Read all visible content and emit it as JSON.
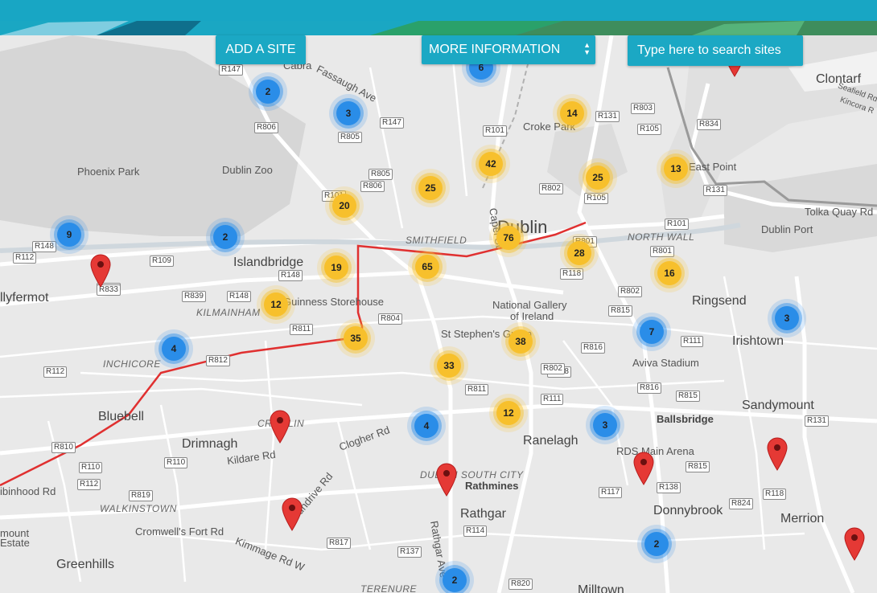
{
  "toolbar": {
    "add_site": "ADD A SITE",
    "more_info": "MORE INFORMATION",
    "search_placeholder": "Type here to search sites"
  },
  "colors": {
    "accent": "#1ba8c4",
    "cluster_yellow": "#f7c02c",
    "cluster_blue": "#2a8de8",
    "pin_red": "#e53935",
    "route_red": "#e03030"
  },
  "map": {
    "place_labels": [
      {
        "text": "Cabra",
        "style": "lbl"
      },
      {
        "text": "Fassaugh Ave",
        "style": "lbl"
      },
      {
        "text": "Clontarf",
        "style": "big"
      },
      {
        "text": "Seafield Rd",
        "style": "lbl"
      },
      {
        "text": "Kincora R",
        "style": "lbl"
      },
      {
        "text": "Phoenix Park",
        "style": "lbl"
      },
      {
        "text": "Dublin Zoo",
        "style": "lbl"
      },
      {
        "text": "Croke Park",
        "style": "lbl"
      },
      {
        "text": "East Point",
        "style": "lbl"
      },
      {
        "text": "Dublin",
        "style": "city"
      },
      {
        "text": "Tolka Quay Rd",
        "style": "lbl"
      },
      {
        "text": "Dublin Port",
        "style": "lbl"
      },
      {
        "text": "SMITHFIELD",
        "style": "ital"
      },
      {
        "text": "NORTH WALL",
        "style": "ital"
      },
      {
        "text": "Islandbridge",
        "style": "big"
      },
      {
        "text": "llyfermot",
        "style": "big"
      },
      {
        "text": "KILMAINHAM",
        "style": "ital"
      },
      {
        "text": "Guinness Storehouse",
        "style": "lbl"
      },
      {
        "text": "National Gallery",
        "style": "lbl"
      },
      {
        "text": "of Ireland",
        "style": "lbl"
      },
      {
        "text": "Ringsend",
        "style": "big"
      },
      {
        "text": "Irishtown",
        "style": "big"
      },
      {
        "text": "St Stephen's Green",
        "style": "lbl"
      },
      {
        "text": "INCHICORE",
        "style": "ital"
      },
      {
        "text": "Aviva Stadium",
        "style": "lbl"
      },
      {
        "text": "Bluebell",
        "style": "big"
      },
      {
        "text": "CRUMLIN",
        "style": "ital"
      },
      {
        "text": "Clogher Rd",
        "style": "lbl"
      },
      {
        "text": "Drimnagh",
        "style": "big"
      },
      {
        "text": "Kildare Rd",
        "style": "lbl"
      },
      {
        "text": "Ranelagh",
        "style": "big"
      },
      {
        "text": "Ballsbridge",
        "style": "bold"
      },
      {
        "text": "Sandymount",
        "style": "big"
      },
      {
        "text": "RDS Main Arena",
        "style": "lbl"
      },
      {
        "text": "DUBLIN SOUTH CITY",
        "style": "ital"
      },
      {
        "text": "Rathmines",
        "style": "bold"
      },
      {
        "text": "Rathgar",
        "style": "big"
      },
      {
        "text": "WALKINSTOWN",
        "style": "ital"
      },
      {
        "text": "Donnybrook",
        "style": "big"
      },
      {
        "text": "Merrion",
        "style": "big"
      },
      {
        "text": "Cromwell's Fort Rd",
        "style": "lbl"
      },
      {
        "text": "Sundrive Rd",
        "style": "lbl"
      },
      {
        "text": "mount",
        "style": "lbl"
      },
      {
        "text": "Estate",
        "style": "lbl"
      },
      {
        "text": "Kimmage Rd W",
        "style": "lbl"
      },
      {
        "text": "Rathgar Ave",
        "style": "lbl"
      },
      {
        "text": "Greenhills",
        "style": "big"
      },
      {
        "text": "TERENURE",
        "style": "ital"
      },
      {
        "text": "Milltown",
        "style": "big"
      },
      {
        "text": "ibinhood Rd",
        "style": "lbl"
      },
      {
        "text": "Capel St",
        "style": "lbl"
      }
    ],
    "road_shields": [
      "R147",
      "R806",
      "R805",
      "R147",
      "R101",
      "R803",
      "R131",
      "R105",
      "R834",
      "R805",
      "R806",
      "R101",
      "R802",
      "R105",
      "R131",
      "R101",
      "R801",
      "R148",
      "R112",
      "R109",
      "R833",
      "R148",
      "R801",
      "R118",
      "R833",
      "R839",
      "R148",
      "R804",
      "R811",
      "R802",
      "R815",
      "R111",
      "R812",
      "R816",
      "R138",
      "R802",
      "R112",
      "R811",
      "R111",
      "R816",
      "R815",
      "R131",
      "R810",
      "R110",
      "R110",
      "R112",
      "R819",
      "R138",
      "R117",
      "R118",
      "R824",
      "R114",
      "R817",
      "R137",
      "R820",
      "R815"
    ],
    "clusters": [
      {
        "count": "2",
        "color": "blue"
      },
      {
        "count": "3",
        "color": "blue"
      },
      {
        "count": "6",
        "color": "blue"
      },
      {
        "count": "14",
        "color": "yellow"
      },
      {
        "count": "42",
        "color": "yellow"
      },
      {
        "count": "25",
        "color": "yellow"
      },
      {
        "count": "13",
        "color": "yellow"
      },
      {
        "count": "25",
        "color": "yellow"
      },
      {
        "count": "20",
        "color": "yellow"
      },
      {
        "count": "9",
        "color": "blue"
      },
      {
        "count": "2",
        "color": "blue"
      },
      {
        "count": "76",
        "color": "yellow"
      },
      {
        "count": "28",
        "color": "yellow"
      },
      {
        "count": "19",
        "color": "yellow"
      },
      {
        "count": "65",
        "color": "yellow"
      },
      {
        "count": "16",
        "color": "yellow"
      },
      {
        "count": "12",
        "color": "yellow"
      },
      {
        "count": "3",
        "color": "blue"
      },
      {
        "count": "35",
        "color": "yellow"
      },
      {
        "count": "7",
        "color": "blue"
      },
      {
        "count": "38",
        "color": "yellow"
      },
      {
        "count": "4",
        "color": "blue"
      },
      {
        "count": "33",
        "color": "yellow"
      },
      {
        "count": "12",
        "color": "yellow"
      },
      {
        "count": "4",
        "color": "blue"
      },
      {
        "count": "3",
        "color": "blue"
      },
      {
        "count": "2",
        "color": "blue"
      },
      {
        "count": "2",
        "color": "blue"
      }
    ],
    "pins": [
      "site-pin",
      "site-pin",
      "site-pin",
      "site-pin",
      "site-pin",
      "site-pin",
      "site-pin",
      "site-pin"
    ]
  }
}
